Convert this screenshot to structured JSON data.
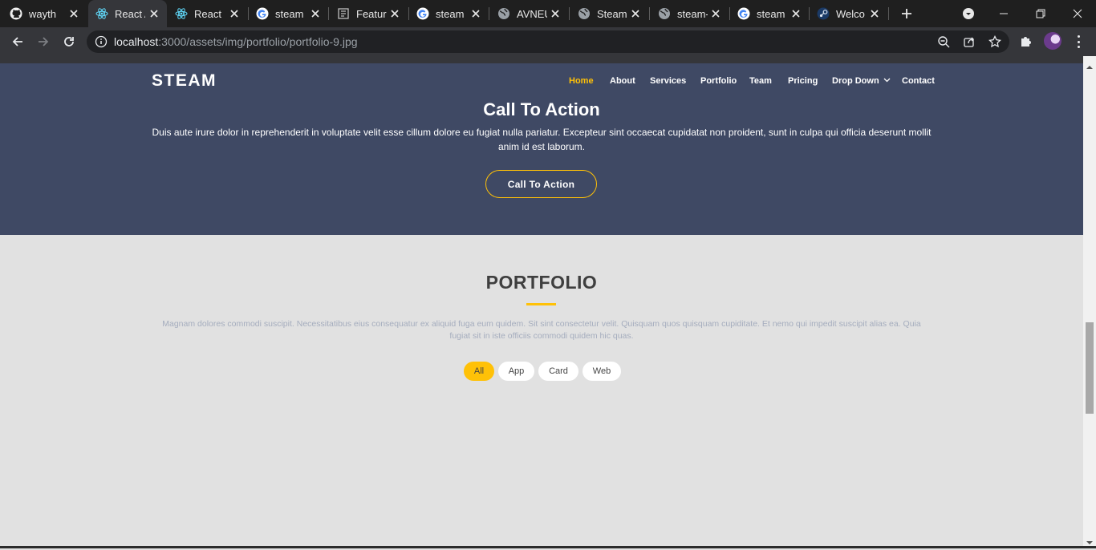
{
  "browser": {
    "tabs": [
      {
        "title": "wayth",
        "icon": "github-icon",
        "active": false
      },
      {
        "title": "React A",
        "icon": "react-icon",
        "active": true
      },
      {
        "title": "React",
        "icon": "react-icon",
        "active": false
      },
      {
        "title": "steam",
        "icon": "google-icon",
        "active": false
      },
      {
        "title": "Featur",
        "icon": "page-icon",
        "active": false
      },
      {
        "title": "steam",
        "icon": "google-icon",
        "active": false
      },
      {
        "title": "AVNEU",
        "icon": "globe-icon",
        "active": false
      },
      {
        "title": "Steam",
        "icon": "globe-icon",
        "active": false
      },
      {
        "title": "steam-",
        "icon": "globe-icon",
        "active": false
      },
      {
        "title": "steam",
        "icon": "google-icon",
        "active": false
      },
      {
        "title": "Welco",
        "icon": "steam-icon",
        "active": false
      }
    ],
    "url_host": "localhost",
    "url_path": ":3000/assets/img/portfolio/portfolio-9.jpg"
  },
  "site": {
    "logo": "STEAM",
    "nav": [
      {
        "label": "Home",
        "active": true
      },
      {
        "label": "About",
        "active": false
      },
      {
        "label": "Services",
        "active": false
      },
      {
        "label": "Portfolio",
        "active": false
      },
      {
        "label": "Team",
        "active": false
      },
      {
        "label": "Pricing",
        "active": false
      },
      {
        "label": "Drop Down",
        "active": false
      },
      {
        "label": "Contact",
        "active": false
      }
    ],
    "cta": {
      "title": "Call To Action",
      "text": "Duis aute irure dolor in reprehenderit in voluptate velit esse cillum dolore eu fugiat nulla pariatur. Excepteur sint occaecat cupidatat non proident, sunt in culpa qui officia deserunt mollit anim id est laborum.",
      "button": "Call To Action"
    },
    "portfolio": {
      "title": "PORTFOLIO",
      "text": "Magnam dolores commodi suscipit. Necessitatibus eius consequatur ex aliquid fuga eum quidem. Sit sint consectetur velit. Quisquam quos quisquam cupiditate. Et nemo qui impedit suscipit alias ea. Quia fugiat sit in iste officiis commodi quidem hic quas.",
      "filters": [
        {
          "label": "All",
          "active": true
        },
        {
          "label": "App",
          "active": false
        },
        {
          "label": "Card",
          "active": false
        },
        {
          "label": "Web",
          "active": false
        }
      ]
    }
  },
  "colors": {
    "hero_bg": "#3f4964",
    "accent": "#ffc107",
    "page_bg": "#e1e1e1"
  }
}
